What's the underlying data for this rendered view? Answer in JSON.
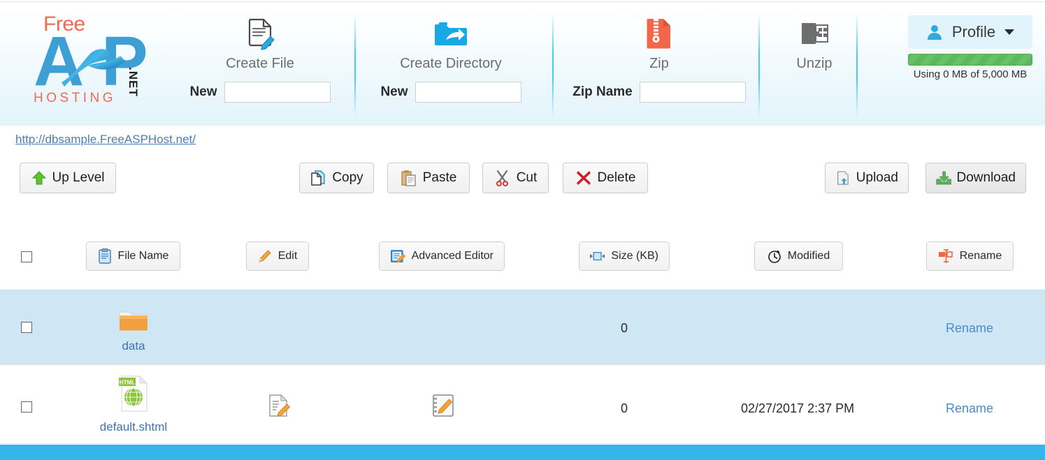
{
  "brand": {
    "free": "Free",
    "a": "A",
    "p": "P",
    "hosting": "HOSTING",
    "net": ".NET"
  },
  "header": {
    "tools": [
      {
        "icon": "create-file-icon",
        "label": "Create File",
        "field_label": "New",
        "value": "",
        "placeholder": ""
      },
      {
        "icon": "create-directory-icon",
        "label": "Create Directory",
        "field_label": "New",
        "value": "",
        "placeholder": ""
      },
      {
        "icon": "zip-icon",
        "label": "Zip",
        "field_label": "Zip Name",
        "value": "",
        "placeholder": ""
      },
      {
        "icon": "unzip-icon",
        "label": "Unzip",
        "field_label": "",
        "value": "",
        "placeholder": ""
      }
    ],
    "profile": {
      "label": "Profile",
      "icon": "user-icon",
      "caret_icon": "chevron-down-icon",
      "storage_text": "Using 0 MB of 5,000 MB",
      "storage_percent": 0,
      "bar_color": "#5cb85c"
    }
  },
  "url": "http://dbsample.FreeASPHost.net/",
  "actions": [
    {
      "label": "Up Level",
      "icon": "up-arrow-icon"
    },
    {
      "label": "Copy",
      "icon": "copy-icon"
    },
    {
      "label": "Paste",
      "icon": "paste-icon"
    },
    {
      "label": "Cut",
      "icon": "scissors-icon"
    },
    {
      "label": "Delete",
      "icon": "red-x-icon"
    },
    {
      "label": "Upload",
      "icon": "upload-icon"
    },
    {
      "label": "Download",
      "icon": "download-icon"
    }
  ],
  "columns": [
    {
      "label": "File Name",
      "icon": "clipboard-icon"
    },
    {
      "label": "Edit",
      "icon": "pencil-icon"
    },
    {
      "label": "Advanced Editor",
      "icon": "advanced-editor-icon"
    },
    {
      "label": "Size (KB)",
      "icon": "resize-icon"
    },
    {
      "label": "Modified",
      "icon": "clock-icon"
    },
    {
      "label": "Rename",
      "icon": "rename-icon"
    }
  ],
  "rows": [
    {
      "name": "data",
      "type": "folder",
      "icon": "folder-icon",
      "size": "0",
      "modified": "",
      "rename": "Rename",
      "selected": true,
      "has_edit": false
    },
    {
      "name": "default.shtml",
      "type": "file",
      "icon": "html-file-icon",
      "size": "0",
      "modified": "02/27/2017 2:37 PM",
      "rename": "Rename",
      "selected": false,
      "has_edit": true,
      "edit_icon": "edit-doc-icon",
      "advanced_edit_icon": "advanced-edit-doc-icon"
    }
  ]
}
